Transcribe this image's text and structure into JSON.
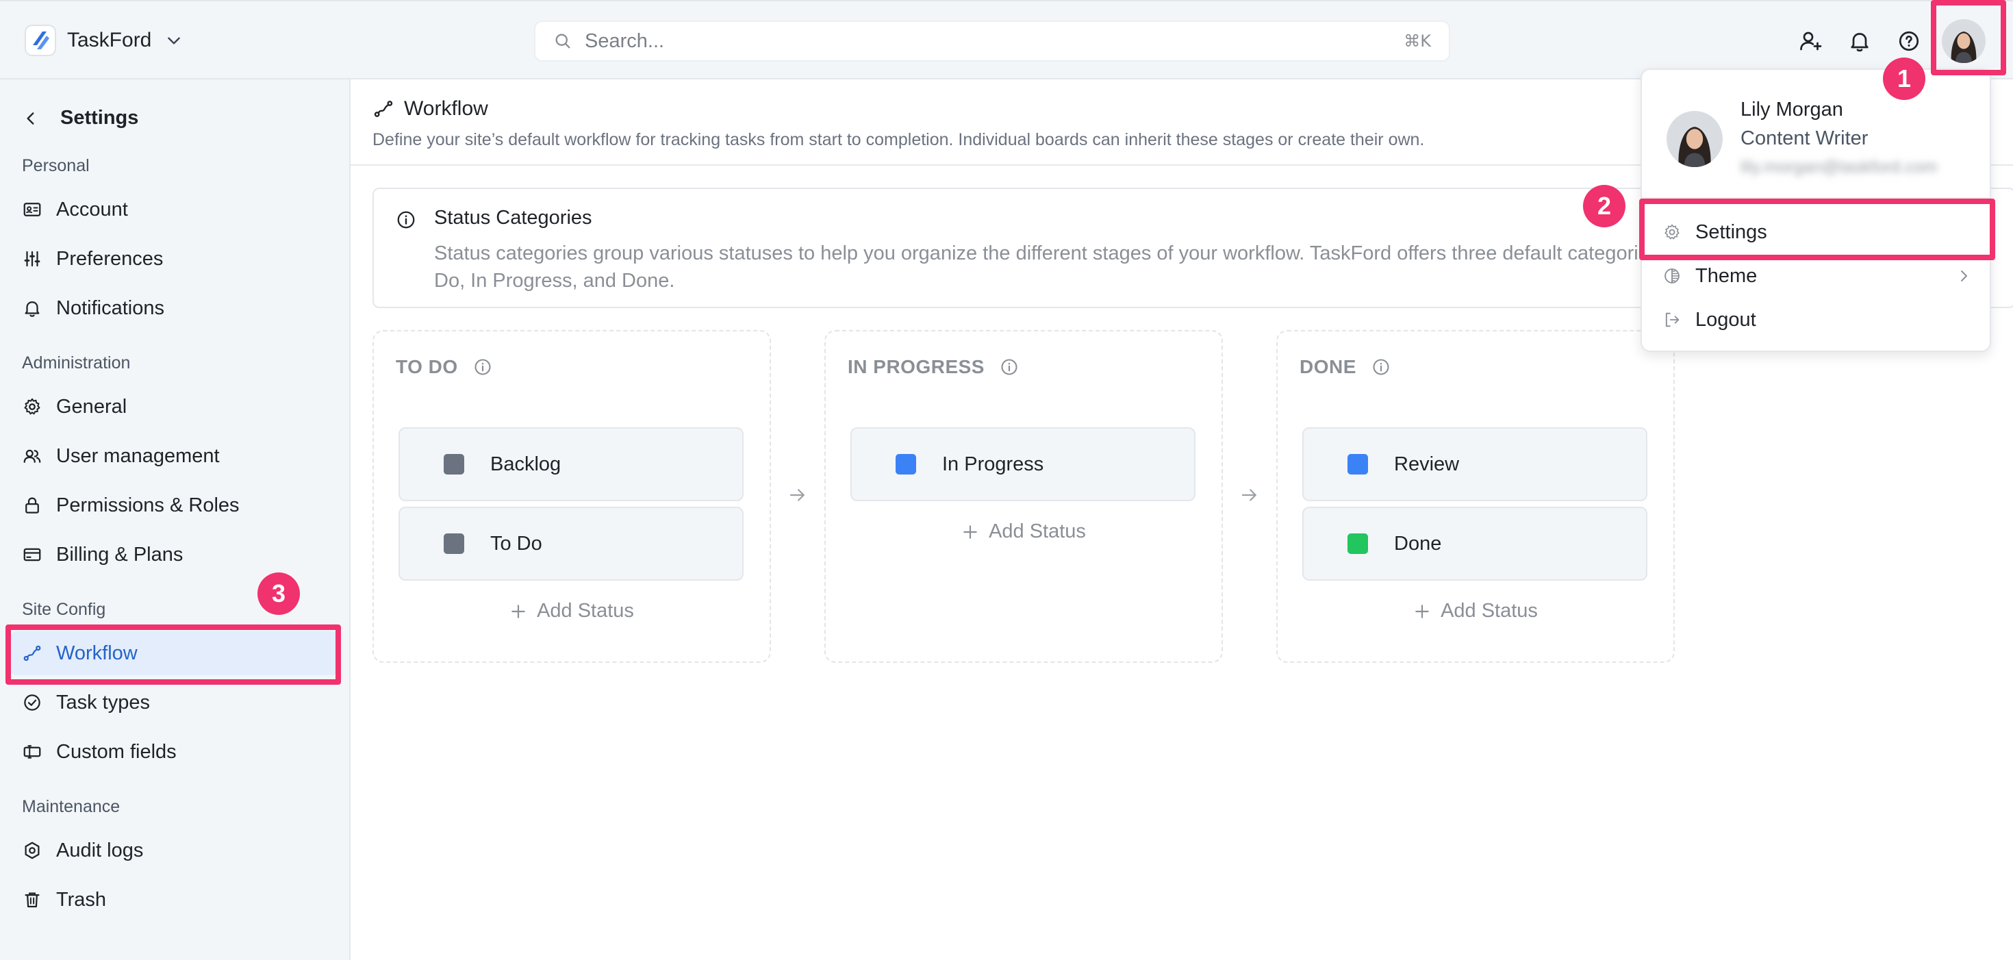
{
  "app": {
    "name": "TaskFord"
  },
  "search": {
    "placeholder": "Search...",
    "shortcut": "⌘K"
  },
  "sidebar": {
    "back_title": "Settings",
    "sections": {
      "personal": "Personal",
      "administration": "Administration",
      "site_config": "Site Config",
      "maintenance": "Maintenance"
    },
    "items": {
      "account": "Account",
      "preferences": "Preferences",
      "notifications": "Notifications",
      "general": "General",
      "user_management": "User management",
      "permissions": "Permissions & Roles",
      "billing": "Billing & Plans",
      "workflow": "Workflow",
      "task_types": "Task types",
      "custom_fields": "Custom fields",
      "audit_logs": "Audit logs",
      "trash": "Trash"
    }
  },
  "page": {
    "title": "Workflow",
    "description": "Define your site’s default workflow for tracking tasks from start to completion. Individual boards can inherit these stages or create their own."
  },
  "info": {
    "title": "Status Categories",
    "text": "Status categories group various statuses to help you organize the different stages of your workflow. TaskFord offers three default categories: To Do, In Progress, and Done."
  },
  "columns": [
    {
      "title": "TO DO",
      "statuses": [
        {
          "label": "Backlog",
          "color": "#6b7280"
        },
        {
          "label": "To Do",
          "color": "#6b7280"
        }
      ],
      "add_label": "Add Status"
    },
    {
      "title": "IN PROGRESS",
      "statuses": [
        {
          "label": "In Progress",
          "color": "#3b82f6"
        }
      ],
      "add_label": "Add Status"
    },
    {
      "title": "DONE",
      "statuses": [
        {
          "label": "Review",
          "color": "#3b82f6"
        },
        {
          "label": "Done",
          "color": "#22c55e"
        }
      ],
      "add_label": "Add Status"
    }
  ],
  "user_menu": {
    "name": "Lily Morgan",
    "role": "Content Writer",
    "email": "lily.morgan@taskford.com",
    "items": {
      "settings": "Settings",
      "theme": "Theme",
      "logout": "Logout"
    }
  },
  "annotations": {
    "badge_1": "1",
    "badge_2": "2",
    "badge_3": "3",
    "color": "#f0326e"
  },
  "colors": {
    "accent": "#2563c9",
    "active_bg": "#e3edfb",
    "sidebar_bg": "#f3f6f8"
  }
}
